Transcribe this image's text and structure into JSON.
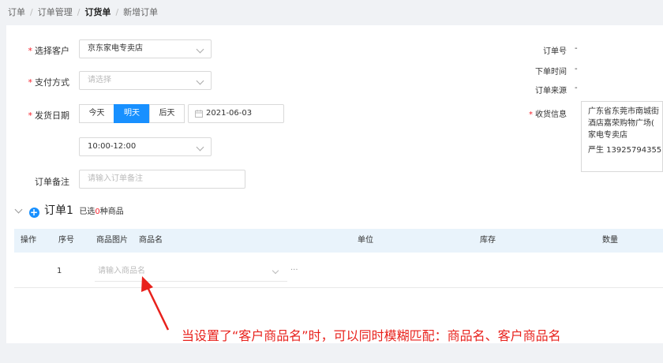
{
  "breadcrumb": [
    "订单",
    "订单管理",
    "订货单",
    "新增订单"
  ],
  "form": {
    "customer_label": "选择客户",
    "customer_value": "京东家电专卖店",
    "payment_label": "支付方式",
    "payment_placeholder": "请选择",
    "ship_date_label": "发货日期",
    "day_options": [
      "今天",
      "明天",
      "后天"
    ],
    "day_selected": "明天",
    "date_value": "2021-06-03",
    "time_value": "10:00-12:00",
    "remark_label": "订单备注",
    "remark_placeholder": "请输入订单备注"
  },
  "order_info": {
    "order_no_label": "订单号",
    "order_no_value": "-",
    "order_time_label": "下单时间",
    "order_time_value": "-",
    "order_source_label": "订单来源",
    "order_source_value": "-",
    "receiver_label": "收货信息",
    "address_lines": [
      "广东省东莞市南城街",
      "酒店嘉荣购物广场(",
      "家电专卖店",
      "严生 13925794355"
    ]
  },
  "order_group": {
    "title": "订单1",
    "selected_prefix": "已选",
    "selected_count": "0",
    "selected_suffix": "种商品"
  },
  "table": {
    "headers": [
      "操作",
      "序号",
      "商品图片",
      "商品名",
      "单位",
      "库存",
      "数量"
    ],
    "row_index": "1",
    "product_placeholder": "请输入商品名",
    "more": "···"
  },
  "annotation": "当设置了“客户商品名”时，可以同时模糊匹配：商品名、客户商品名",
  "colors": {
    "primary": "#1890ff",
    "required": "#f5222d",
    "annotation": "#e8211c",
    "table_header_bg": "#e9f3fb"
  }
}
